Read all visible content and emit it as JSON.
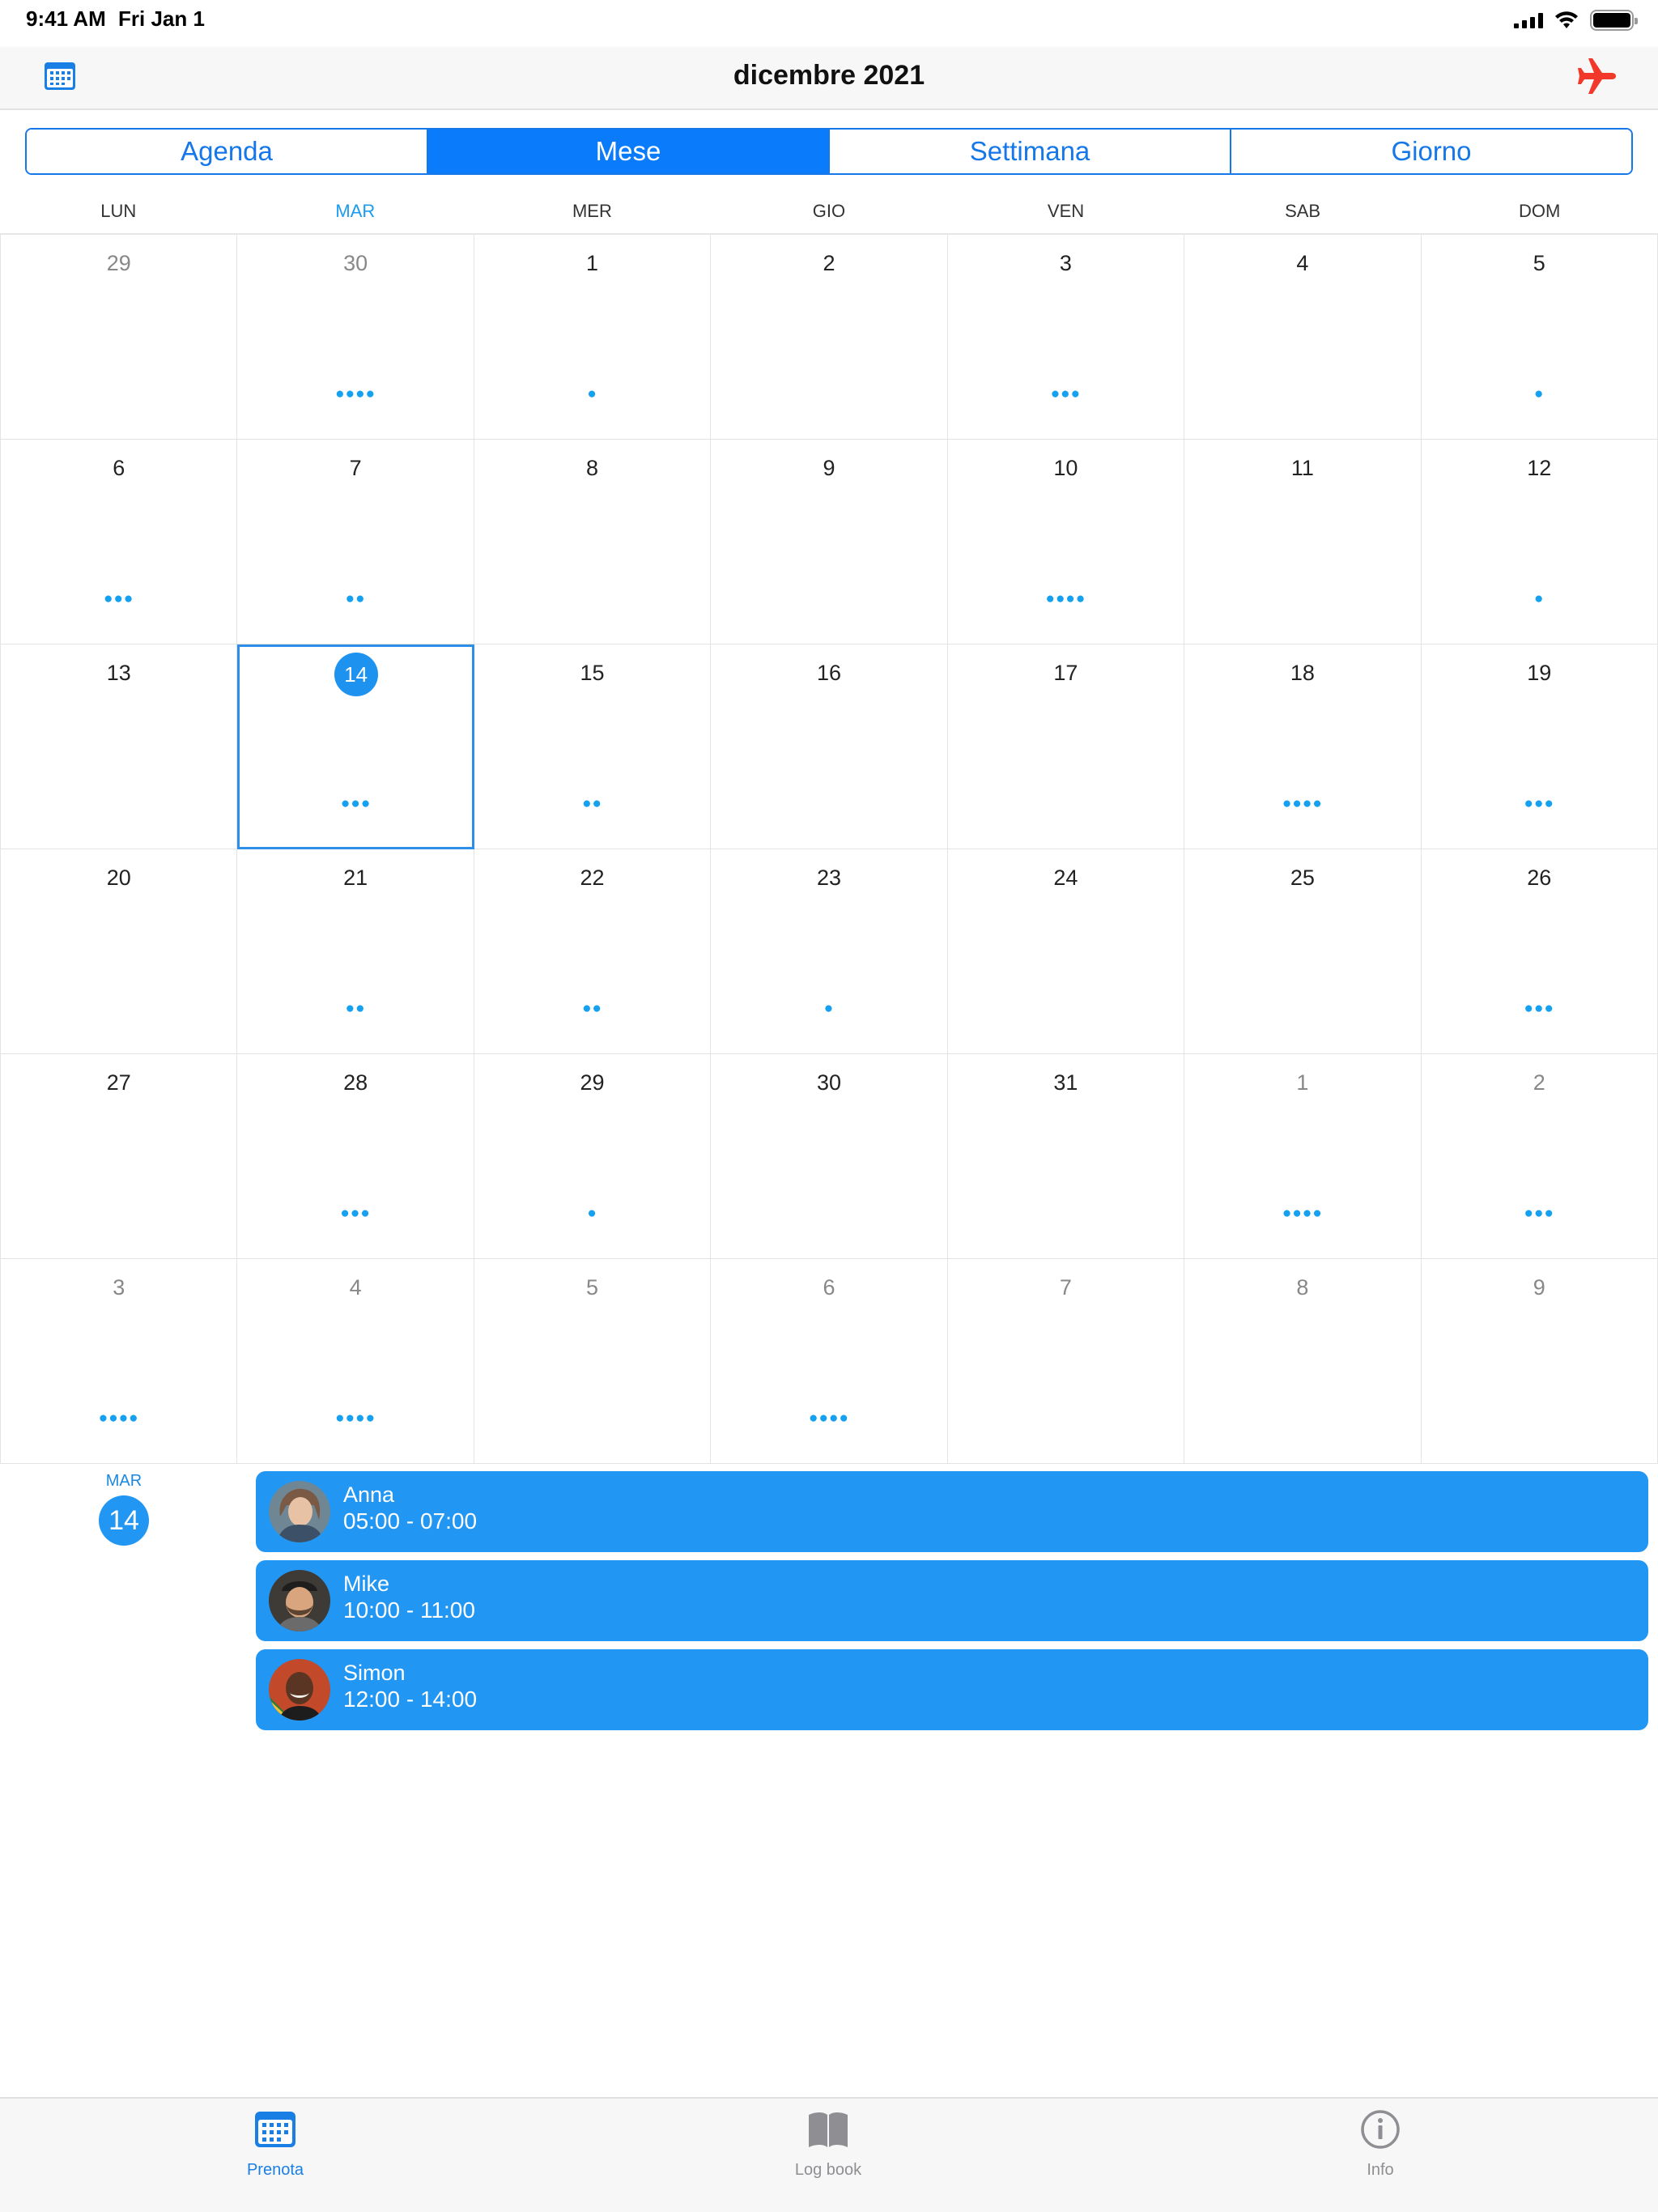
{
  "status_bar": {
    "time": "9:41 AM",
    "date": "Fri Jan 1",
    "icons": [
      "signal-icon",
      "wifi-icon",
      "battery-icon"
    ]
  },
  "nav": {
    "title": "dicembre 2021",
    "left_icon": "calendar-icon",
    "right_icon": "airplane-icon"
  },
  "segments": [
    {
      "label": "Agenda",
      "active": false
    },
    {
      "label": "Mese",
      "active": true
    },
    {
      "label": "Settimana",
      "active": false
    },
    {
      "label": "Giorno",
      "active": false
    }
  ],
  "weekdays": [
    "LUN",
    "MAR",
    "MER",
    "GIO",
    "VEN",
    "SAB",
    "DOM"
  ],
  "calendar": {
    "selected_day": "14",
    "weeks": [
      [
        {
          "day": "29",
          "other": true,
          "dots": 0
        },
        {
          "day": "30",
          "other": true,
          "dots": 4
        },
        {
          "day": "1",
          "dots": 1
        },
        {
          "day": "2",
          "dots": 0
        },
        {
          "day": "3",
          "dots": 3
        },
        {
          "day": "4",
          "dots": 0
        },
        {
          "day": "5",
          "dots": 1
        }
      ],
      [
        {
          "day": "6",
          "dots": 3
        },
        {
          "day": "7",
          "dots": 2
        },
        {
          "day": "8",
          "dots": 0
        },
        {
          "day": "9",
          "dots": 0
        },
        {
          "day": "10",
          "dots": 4
        },
        {
          "day": "11",
          "dots": 0
        },
        {
          "day": "12",
          "dots": 1
        }
      ],
      [
        {
          "day": "13",
          "dots": 0
        },
        {
          "day": "14",
          "dots": 3,
          "selected": true
        },
        {
          "day": "15",
          "dots": 2
        },
        {
          "day": "16",
          "dots": 0
        },
        {
          "day": "17",
          "dots": 0
        },
        {
          "day": "18",
          "dots": 4
        },
        {
          "day": "19",
          "dots": 3
        }
      ],
      [
        {
          "day": "20",
          "dots": 0
        },
        {
          "day": "21",
          "dots": 2
        },
        {
          "day": "22",
          "dots": 2
        },
        {
          "day": "23",
          "dots": 1
        },
        {
          "day": "24",
          "dots": 0
        },
        {
          "day": "25",
          "dots": 0
        },
        {
          "day": "26",
          "dots": 3
        }
      ],
      [
        {
          "day": "27",
          "dots": 0
        },
        {
          "day": "28",
          "dots": 3
        },
        {
          "day": "29",
          "dots": 1
        },
        {
          "day": "30",
          "dots": 0
        },
        {
          "day": "31",
          "dots": 0
        },
        {
          "day": "1",
          "other": true,
          "dots": 4
        },
        {
          "day": "2",
          "other": true,
          "dots": 3
        }
      ],
      [
        {
          "day": "3",
          "other": true,
          "dots": 4
        },
        {
          "day": "4",
          "other": true,
          "dots": 4
        },
        {
          "day": "5",
          "other": true,
          "dots": 0
        },
        {
          "day": "6",
          "other": true,
          "dots": 4
        },
        {
          "day": "7",
          "other": true,
          "dots": 0
        },
        {
          "day": "8",
          "other": true,
          "dots": 0
        },
        {
          "day": "9",
          "other": true,
          "dots": 0
        }
      ]
    ]
  },
  "day_detail": {
    "weekday": "MAR",
    "day": "14",
    "events": [
      {
        "name": "Anna",
        "time": "05:00 - 07:00",
        "avatar": "anna-avatar"
      },
      {
        "name": "Mike",
        "time": "10:00 - 11:00",
        "avatar": "mike-avatar"
      },
      {
        "name": "Simon",
        "time": "12:00 - 14:00",
        "avatar": "simon-avatar"
      }
    ]
  },
  "tabs": [
    {
      "label": "Prenota",
      "icon": "calendar-icon",
      "active": true
    },
    {
      "label": "Log book",
      "icon": "book-icon",
      "active": false
    },
    {
      "label": "Info",
      "icon": "info-icon",
      "active": false
    }
  ],
  "colors": {
    "accent": "#0a7cfb",
    "event_bg": "#2196f3",
    "dot": "#15a0f0",
    "plane": "#f2382b"
  }
}
